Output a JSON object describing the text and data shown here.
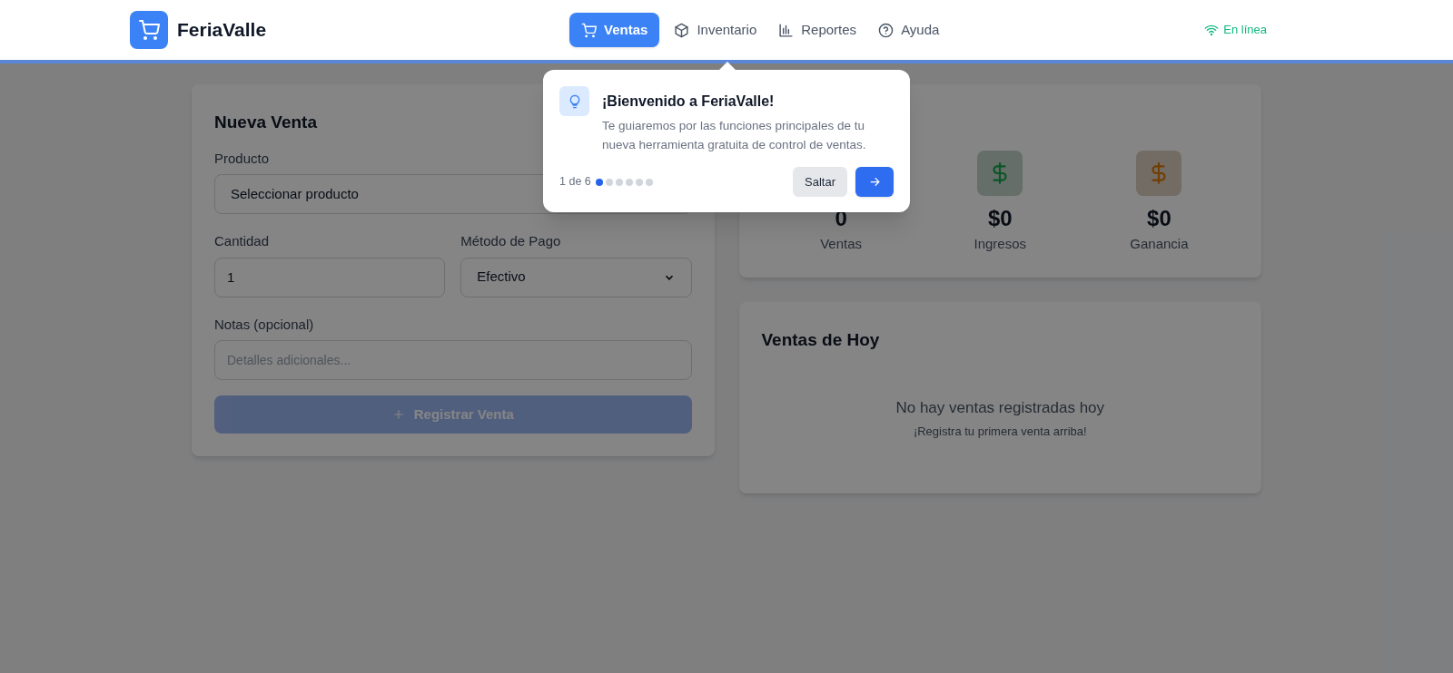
{
  "header": {
    "brand": "FeriaValle",
    "nav": [
      {
        "label": "Ventas",
        "selected": true
      },
      {
        "label": "Inventario",
        "selected": false
      },
      {
        "label": "Reportes",
        "selected": false
      },
      {
        "label": "Ayuda",
        "selected": false
      }
    ],
    "status": "En línea"
  },
  "new_sale": {
    "title": "Nueva Venta",
    "product_label": "Producto",
    "product_value": "Seleccionar producto",
    "quantity_label": "Cantidad",
    "quantity_value": "1",
    "payment_label": "Método de Pago",
    "payment_value": "Efectivo",
    "notes_label": "Notas (opcional)",
    "notes_placeholder": "Detalles adicionales...",
    "submit": {
      "label": "Registrar Venta",
      "disabled": true
    }
  },
  "stats": [
    {
      "value": "0",
      "label": "Ventas"
    },
    {
      "value": "$0",
      "label": "Ingresos",
      "color": "#0b5526"
    },
    {
      "value": "$0",
      "label": "Ganancia",
      "color": "#713e03"
    }
  ],
  "today": {
    "title": "Ventas de Hoy",
    "empty_title": "No hay ventas registradas hoy",
    "empty_hint": "¡Registra tu primera venta arriba!"
  },
  "tour": {
    "title": "¡Bienvenido a FeriaValle!",
    "text": "Te guiaremos por las funciones principales de tu nueva herramienta gratuita de control de ventas.",
    "step": "1 de 6",
    "dots": [
      {
        "selected": true
      },
      {
        "selected": false
      },
      {
        "selected": false
      },
      {
        "selected": false
      },
      {
        "selected": false
      },
      {
        "selected": false
      }
    ],
    "skip": "Saltar"
  }
}
